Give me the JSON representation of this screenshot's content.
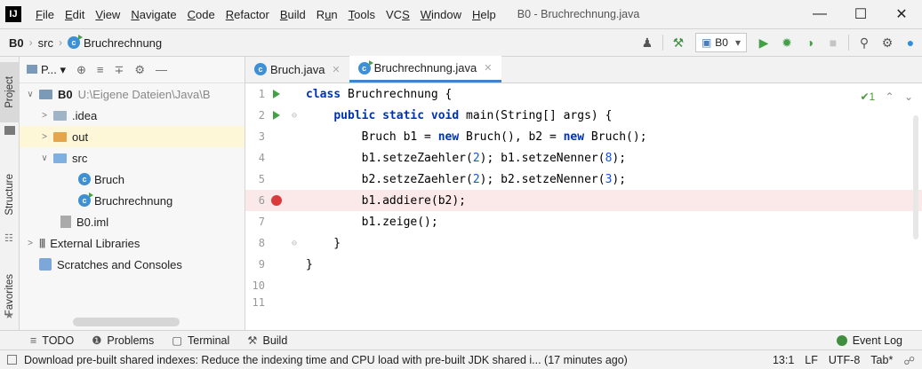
{
  "menubar": {
    "logo": "IJ",
    "items": [
      {
        "label": "File",
        "u": "F",
        "rest": "ile"
      },
      {
        "label": "Edit",
        "u": "E",
        "rest": "dit"
      },
      {
        "label": "View",
        "u": "V",
        "rest": "iew"
      },
      {
        "label": "Navigate",
        "u": "N",
        "rest": "avigate"
      },
      {
        "label": "Code",
        "u": "C",
        "rest": "ode"
      },
      {
        "label": "Refactor",
        "u": "R",
        "rest": "efactor"
      },
      {
        "label": "Build",
        "u": "B",
        "rest": "uild"
      },
      {
        "label": "Run",
        "u": "u",
        "rest": "n"
      },
      {
        "label": "Tools",
        "u": "T",
        "rest": "ools"
      },
      {
        "label": "VCS",
        "u": "S",
        "rest": ""
      },
      {
        "label": "Window",
        "u": "W",
        "rest": "indow"
      },
      {
        "label": "Help",
        "u": "H",
        "rest": "elp"
      }
    ],
    "window_title": "B0 - Bruchrechnung.java",
    "minimize": "—",
    "maximize": "☐",
    "close": "✕"
  },
  "breadcrumb": {
    "project": "B0",
    "folder": "src",
    "class": "Bruchrechnung"
  },
  "run_config": {
    "name": "B0",
    "dropdown": "▾"
  },
  "left_strip": {
    "project": "Project",
    "structure": "Structure",
    "favorites": "Favorites"
  },
  "project_toolbar": {
    "view_label": "P..."
  },
  "tree": {
    "root_name": "B0",
    "root_path": "U:\\Eigene Dateien\\Java\\B",
    "idea": ".idea",
    "out": "out",
    "src": "src",
    "bruch": "Bruch",
    "bruchrechnung": "Bruchrechnung",
    "iml": "B0.iml",
    "ext_libs": "External Libraries",
    "scratches": "Scratches and Consoles"
  },
  "tabs": [
    {
      "label": "Bruch.java"
    },
    {
      "label": "Bruchrechnung.java"
    }
  ],
  "inspection": {
    "count": "✔1",
    "up": "⌃",
    "down": "⌄"
  },
  "code_lines": [
    {
      "num": "1",
      "text": ""
    },
    {
      "num": "2",
      "text": ""
    },
    {
      "num": "3",
      "text": ""
    },
    {
      "num": "4",
      "text": ""
    },
    {
      "num": "5",
      "text": ""
    },
    {
      "num": "6",
      "text": ""
    },
    {
      "num": "7",
      "text": ""
    },
    {
      "num": "8",
      "text": ""
    },
    {
      "num": "9",
      "text": ""
    },
    {
      "num": "10",
      "text": ""
    },
    {
      "num": "11",
      "text": ""
    }
  ],
  "tool_windows": {
    "todo": "TODO",
    "problems": "Problems",
    "terminal": "Terminal",
    "build": "Build",
    "event_log": "Event Log"
  },
  "status": {
    "message": "Download pre-built shared indexes: Reduce the indexing time and CPU load with pre-built JDK shared i... (17 minutes ago)",
    "position": "13:1",
    "line_sep": "LF",
    "encoding": "UTF-8",
    "indent": "Tab*"
  },
  "colors": {
    "accent": "#4083c9",
    "breakpoint": "#db3a3a",
    "run": "#43a047",
    "keyword": "#0033b3",
    "number": "#1750eb"
  }
}
